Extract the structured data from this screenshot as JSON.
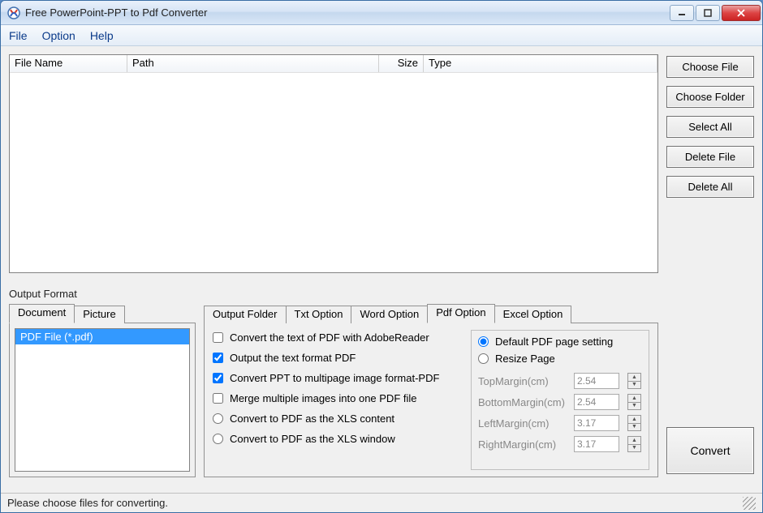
{
  "window": {
    "title": "Free PowerPoint-PPT to Pdf Converter"
  },
  "menu": {
    "file": "File",
    "option": "Option",
    "help": "Help"
  },
  "filelist": {
    "col_filename": "File Name",
    "col_path": "Path",
    "col_size": "Size",
    "col_type": "Type"
  },
  "buttons": {
    "choose_file": "Choose File",
    "choose_folder": "Choose Folder",
    "select_all": "Select All",
    "delete_file": "Delete File",
    "delete_all": "Delete All",
    "convert": "Convert"
  },
  "output_format_label": "Output Format",
  "format_tabs": {
    "document": "Document",
    "picture": "Picture"
  },
  "format_items": {
    "pdf": "PDF File  (*.pdf)"
  },
  "option_tabs": {
    "output_folder": "Output Folder",
    "txt": "Txt Option",
    "word": "Word Option",
    "pdf": "Pdf Option",
    "excel": "Excel Option"
  },
  "pdf_options": {
    "convert_adobe": "Convert the text of PDF with AdobeReader",
    "output_text_pdf": "Output the text format PDF",
    "ppt_multipage": "Convert PPT to multipage image format-PDF",
    "merge_images": "Merge multiple images into one PDF file",
    "xls_content": "Convert to PDF as the XLS content",
    "xls_window": "Convert to PDF as the XLS window"
  },
  "page_settings": {
    "default_label": "Default PDF page setting",
    "resize_label": "Resize Page",
    "top_label": "TopMargin(cm)",
    "bottom_label": "BottomMargin(cm)",
    "left_label": "LeftMargin(cm)",
    "right_label": "RightMargin(cm)",
    "top_val": "2.54",
    "bottom_val": "2.54",
    "left_val": "3.17",
    "right_val": "3.17"
  },
  "status": "Please choose files for converting."
}
